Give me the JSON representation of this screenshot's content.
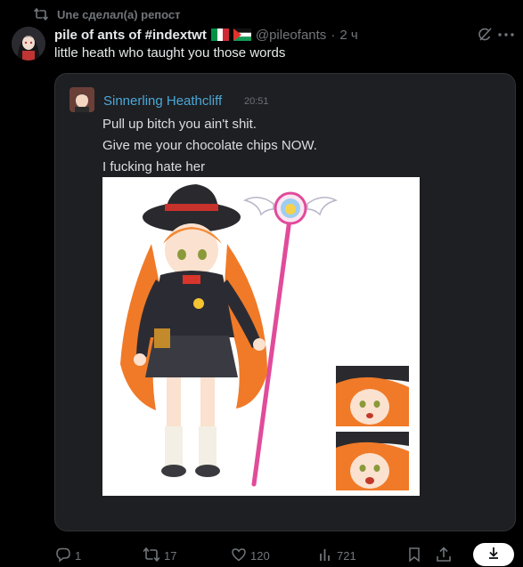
{
  "repost": {
    "text": "Une сделал(а) репост",
    "icon": "repost-icon"
  },
  "author": {
    "display_name": "pile of ants of #indextwt",
    "flags": [
      "italy-flag",
      "palestine-flag"
    ],
    "handle": "@pileofants",
    "separator": "·",
    "time": "2 ч"
  },
  "post": {
    "text": "little heath who taught you those words"
  },
  "embedded_message": {
    "author": "Sinnerling Heathcliff",
    "time": "20:51",
    "lines": [
      "Pull up bitch you ain't shit.",
      "Give me your chocolate chips NOW.",
      "I fucking hate her"
    ]
  },
  "actions": {
    "replies": "1",
    "reposts": "17",
    "likes": "120",
    "views": "721"
  },
  "colors": {
    "background": "#000000",
    "text": "#e7e9ea",
    "muted": "#71767b",
    "card": "#1e1f22",
    "discord_name": "#4aa8d8"
  }
}
